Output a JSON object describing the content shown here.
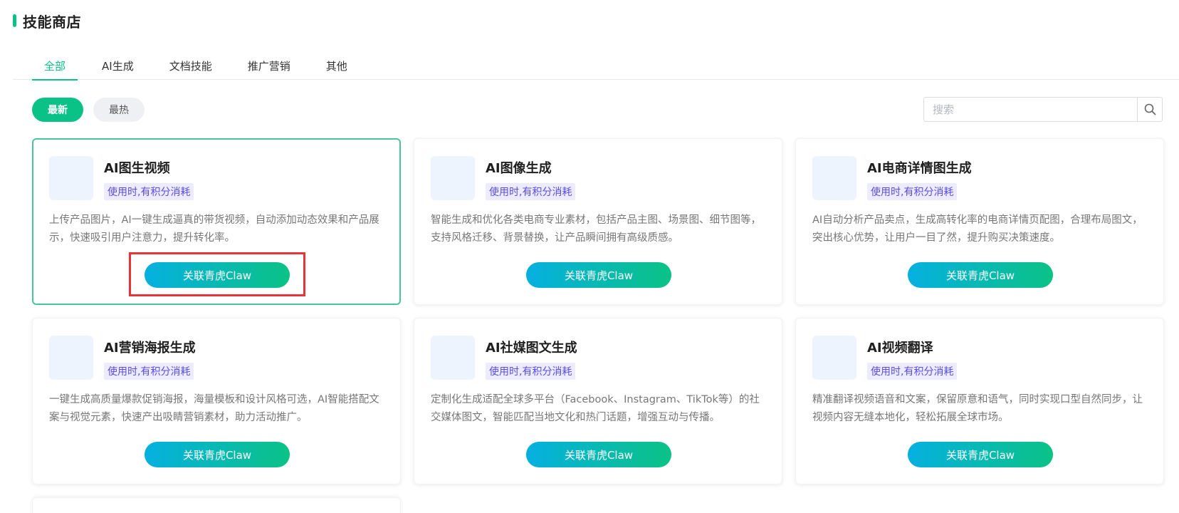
{
  "header": {
    "title": "技能商店"
  },
  "tabs": [
    {
      "label": "全部",
      "active": true
    },
    {
      "label": "AI生成",
      "active": false
    },
    {
      "label": "文档技能",
      "active": false
    },
    {
      "label": "推广营销",
      "active": false
    },
    {
      "label": "其他",
      "active": false
    }
  ],
  "sort": {
    "newest": "最新",
    "hottest": "最热",
    "active": "newest"
  },
  "search": {
    "placeholder": "搜索",
    "value": "",
    "icon": "search-icon"
  },
  "colors": {
    "accent": "#0bc286",
    "tag_bg": "#ecebff",
    "tag_text": "#5b4de8",
    "button_gradient_start": "#05b0e0",
    "button_gradient_end": "#0bc286",
    "highlight": "#e8333a"
  },
  "cards": [
    {
      "title": "AI图生视频",
      "tag": "使用时,有积分消耗",
      "description": "上传产品图片，AI一键生成逼真的带货视频，自动添加动态效果和产品展示，快速吸引用户注意力，提升转化率。",
      "button": "关联青虎Claw",
      "selected": true
    },
    {
      "title": "AI图像生成",
      "tag": "使用时,有积分消耗",
      "description": "智能生成和优化各类电商专业素材，包括产品主图、场景图、细节图等，支持风格迁移、背景替换，让产品瞬间拥有高级质感。",
      "button": "关联青虎Claw",
      "selected": false
    },
    {
      "title": "AI电商详情图生成",
      "tag": "使用时,有积分消耗",
      "description": "AI自动分析产品卖点，生成高转化率的电商详情页配图，合理布局图文，突出核心优势，让用户一目了然，提升购买决策速度。",
      "button": "关联青虎Claw",
      "selected": false
    },
    {
      "title": "AI营销海报生成",
      "tag": "使用时,有积分消耗",
      "description": "一键生成高质量爆款促销海报，海量模板和设计风格可选，AI智能搭配文案与视觉元素，快速产出吸睛营销素材，助力活动推广。",
      "button": "关联青虎Claw",
      "selected": false
    },
    {
      "title": "AI社媒图文生成",
      "tag": "使用时,有积分消耗",
      "description": "定制化生成适配全球多平台（Facebook、Instagram、TikTok等）的社交媒体图文，智能匹配当地文化和热门话题，增强互动与传播。",
      "button": "关联青虎Claw",
      "selected": false
    },
    {
      "title": "AI视频翻译",
      "tag": "使用时,有积分消耗",
      "description": "精准翻译视频语音和文案，保留原意和语气，同时实现口型自然同步，让视频内容无缝本地化，轻松拓展全球市场。",
      "button": "关联青虎Claw",
      "selected": false
    }
  ]
}
